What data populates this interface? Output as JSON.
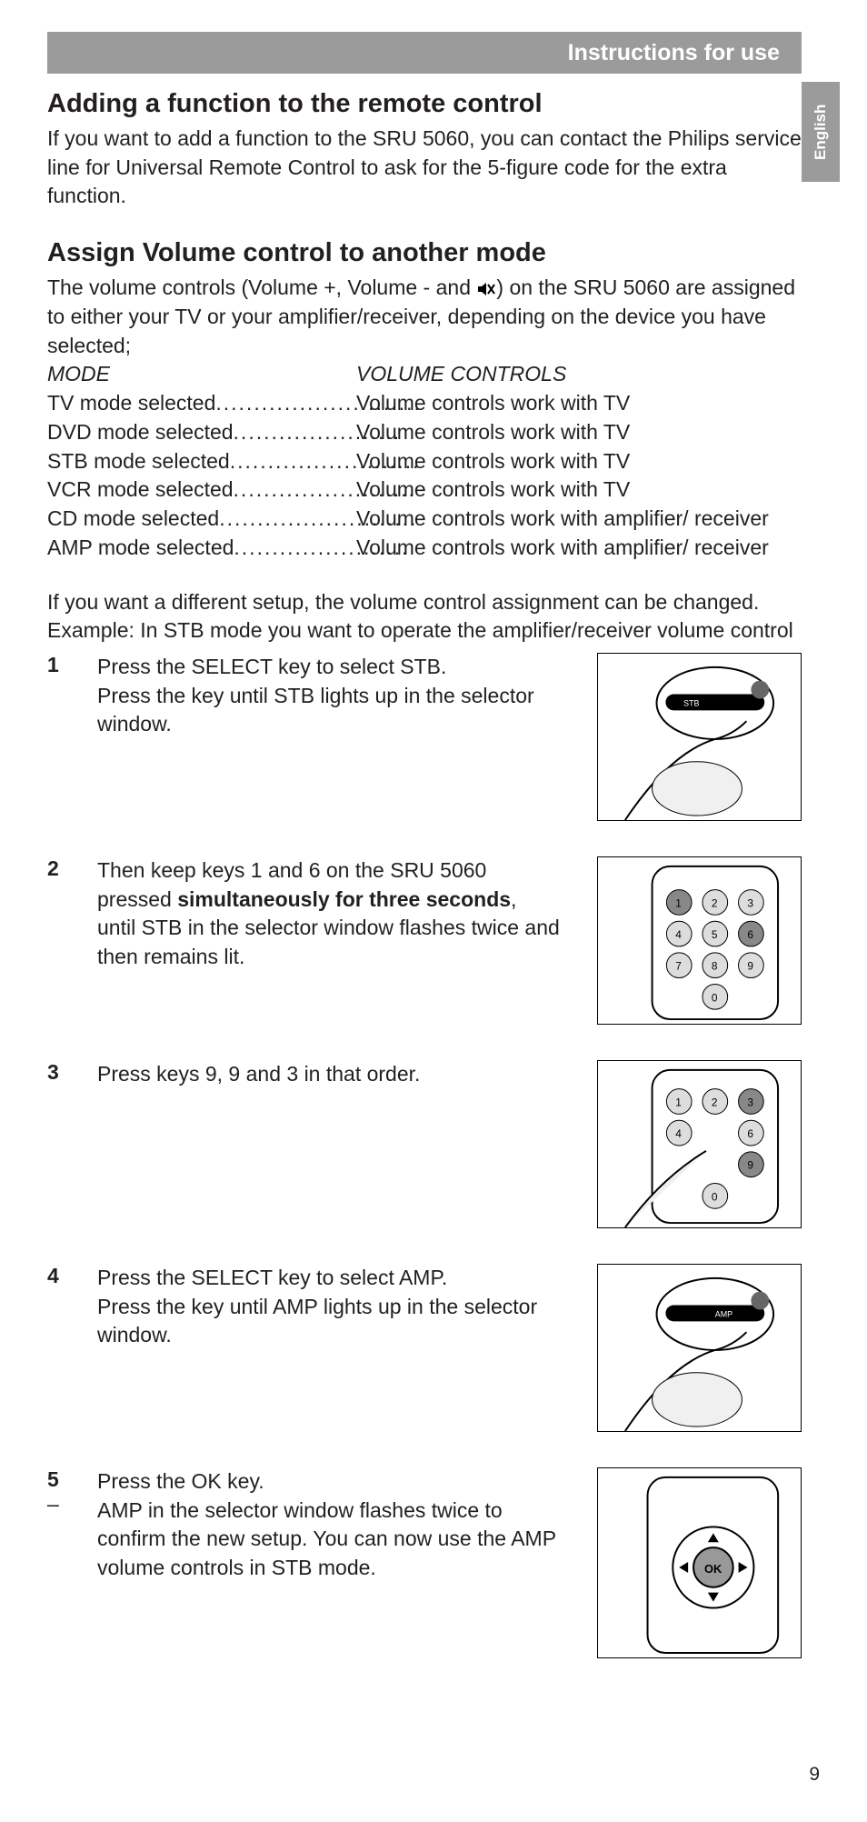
{
  "header": {
    "title": "Instructions for use"
  },
  "lang_tab": "English",
  "section1": {
    "heading": "Adding a function to the remote control",
    "body": "If you want to add a function to the SRU 5060, you can contact the Philips service line for Universal Remote Control to ask for the 5-figure code for the extra function."
  },
  "section2": {
    "heading": "Assign Volume control to another mode",
    "intro_a": "The volume controls (Volume +, Volume - and ",
    "intro_b": ") on the SRU 5060 are assigned to either your TV or your amplifier/receiver, depending on the device you have selected;",
    "mode_header": {
      "left": "MODE",
      "right": "VOLUME CONTROLS"
    },
    "rows": [
      {
        "mode": "TV mode selected",
        "ctrl": "Volume controls work with TV"
      },
      {
        "mode": "DVD mode selected",
        "ctrl": "Volume controls work with TV"
      },
      {
        "mode": "STB mode selected",
        "ctrl": "Volume controls work with TV"
      },
      {
        "mode": "VCR mode selected",
        "ctrl": "Volume controls work with TV"
      },
      {
        "mode": "CD mode selected",
        "ctrl": "Volume controls work with amplifier/ receiver"
      },
      {
        "mode": "AMP mode selected",
        "ctrl": "Volume controls work with amplifier/ receiver"
      }
    ],
    "trailer": "If you want a different setup, the volume control assignment can be changed. Example: In STB mode you want to operate the amplifier/receiver volume control"
  },
  "steps": [
    {
      "num": "1",
      "text_a": "Press the SELECT key to select STB.",
      "text_b": "Press the key until STB lights up in the selector window."
    },
    {
      "num": "2",
      "text_a": "Then keep keys 1 and 6 on the SRU 5060 pressed ",
      "bold": "simultaneously for three seconds",
      "text_b": ", until STB in the selector window flashes twice and then remains lit."
    },
    {
      "num": "3",
      "text_a": "Press keys 9, 9 and 3 in that order."
    },
    {
      "num": "4",
      "text_a": "Press the SELECT key to select AMP.",
      "text_b": "Press the key until AMP lights up in the selector window."
    },
    {
      "num": "5",
      "text_a": "Press the OK key.",
      "dash": "–",
      "text_b": "AMP in the selector window flashes twice to confirm the new setup. You can now use the AMP volume controls in STB mode."
    }
  ],
  "page_number": "9"
}
